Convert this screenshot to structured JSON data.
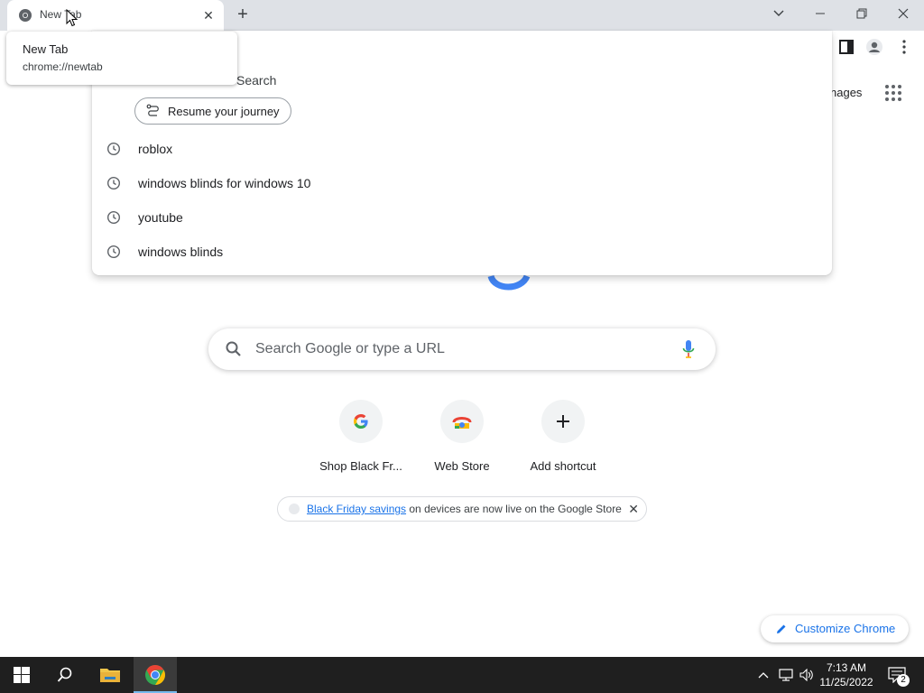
{
  "tab": {
    "title": "New Tab",
    "close": "✕"
  },
  "tooltip": {
    "title": "New Tab",
    "url": "chrome://newtab"
  },
  "omnibox": {
    "partial_suggestion": "Search",
    "journey_button": "Resume your journey",
    "suggestions": [
      "roblox",
      "windows blinds for windows 10",
      "youtube",
      "windows blinds"
    ]
  },
  "ntp": {
    "images_link": "nages",
    "search_placeholder": "Search Google or type a URL",
    "shortcuts": [
      {
        "label": "Shop Black Fr...",
        "icon": "google-g-icon"
      },
      {
        "label": "Web Store",
        "icon": "web-store-icon"
      },
      {
        "label": "Add shortcut",
        "icon": "plus-icon"
      }
    ],
    "promo": {
      "link_text": "Black Friday savings",
      "rest_text": " on devices are now live on the Google Store"
    },
    "customize_label": "Customize Chrome"
  },
  "taskbar": {
    "time": "7:13 AM",
    "date": "11/25/2022",
    "notification_count": "2"
  },
  "colors": {
    "accent": "#1a73e8",
    "tabstrip": "#dee1e6",
    "taskbar": "#1f1f1f"
  }
}
